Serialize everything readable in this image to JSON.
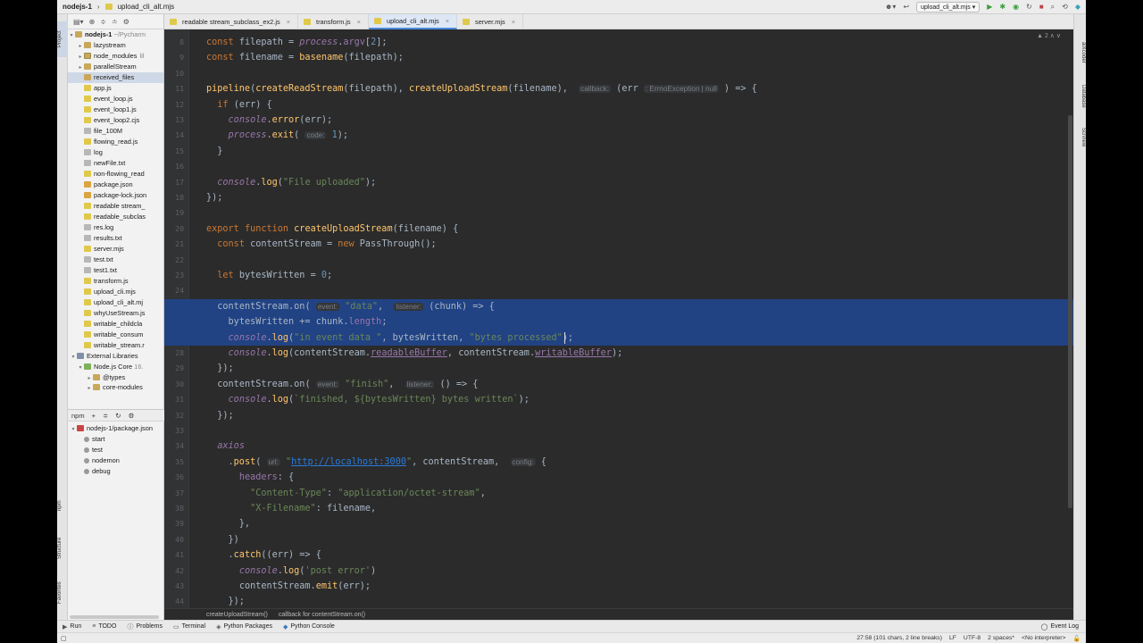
{
  "window": {
    "project": "nodejs-1",
    "current_file": "upload_cli_alt.mjs",
    "run_config": "upload_cli_alt.mjs"
  },
  "tool_windows": {
    "left": [
      "Project",
      "npm",
      "Structure",
      "Favorites"
    ],
    "right": [
      "aiXcoder",
      "Database",
      "SciView"
    ]
  },
  "project_panel": {
    "root": {
      "name": "nodejs-1",
      "path": "~/Pycharm"
    },
    "items": [
      {
        "name": "lazystream",
        "kind": "folder",
        "expandable": true
      },
      {
        "name": "node_modules",
        "kind": "folder-mod",
        "expandable": true,
        "note": "lil"
      },
      {
        "name": "parallelStream",
        "kind": "folder",
        "expandable": true
      },
      {
        "name": "received_files",
        "kind": "folder",
        "expandable": false,
        "selected": true
      },
      {
        "name": "app.js",
        "kind": "js"
      },
      {
        "name": "event_loop.js",
        "kind": "js"
      },
      {
        "name": "event_loop1.js",
        "kind": "js"
      },
      {
        "name": "event_loop2.cjs",
        "kind": "js"
      },
      {
        "name": "file_100M",
        "kind": "txt"
      },
      {
        "name": "flowing_read.js",
        "kind": "js"
      },
      {
        "name": "log",
        "kind": "txt"
      },
      {
        "name": "newFile.txt",
        "kind": "txt"
      },
      {
        "name": "non-flowing_read",
        "kind": "js"
      },
      {
        "name": "package.json",
        "kind": "json"
      },
      {
        "name": "package-lock.json",
        "kind": "json"
      },
      {
        "name": "readable stream_",
        "kind": "js"
      },
      {
        "name": "readable_subclas",
        "kind": "js"
      },
      {
        "name": "res.log",
        "kind": "txt"
      },
      {
        "name": "results.txt",
        "kind": "txt"
      },
      {
        "name": "server.mjs",
        "kind": "js"
      },
      {
        "name": "test.txt",
        "kind": "txt"
      },
      {
        "name": "test1.txt",
        "kind": "txt"
      },
      {
        "name": "transform.js",
        "kind": "js"
      },
      {
        "name": "upload_cli.mjs",
        "kind": "js"
      },
      {
        "name": "upload_cli_alt.mj",
        "kind": "js"
      },
      {
        "name": "whyUseStream.js",
        "kind": "js"
      },
      {
        "name": "writable_childcla",
        "kind": "js"
      },
      {
        "name": "writable_consum",
        "kind": "js"
      },
      {
        "name": "writable_stream.r",
        "kind": "js"
      }
    ],
    "external": {
      "label": "External Libraries",
      "node_core": "Node.js Core",
      "node_core_ver": "16.",
      "types": "@types",
      "core_modules": "core-modules"
    }
  },
  "npm_panel": {
    "title": "npm",
    "package": "nodejs-1/package.json",
    "scripts": [
      "start",
      "test",
      "nodemon",
      "debug"
    ]
  },
  "tabs": [
    {
      "label": "readable stream_subclass_ex2.js",
      "active": false
    },
    {
      "label": "transform.js",
      "active": false
    },
    {
      "label": "upload_cli_alt.mjs",
      "active": true
    },
    {
      "label": "server.mjs",
      "active": false
    }
  ],
  "editor": {
    "line_numbers": [
      "8",
      "9",
      "10",
      "11",
      "12",
      "13",
      "14",
      "15",
      "16",
      "17",
      "18",
      "19",
      "20",
      "21",
      "22",
      "23",
      "24",
      "25",
      "26",
      "27",
      "28",
      "29",
      "30",
      "31",
      "32",
      "33",
      "34",
      "35",
      "36",
      "37",
      "38",
      "39",
      "40",
      "41",
      "42",
      "43",
      "44"
    ],
    "current_line": "27",
    "inspection": "2",
    "code_lines": [
      "const filepath = process.argv[2];",
      "const filename = basename(filepath);",
      "",
      "pipeline(createReadStream(filepath), createUploadStream(filename),  callback: (err : ErrnoException | null ) => {",
      "  if (err) {",
      "    console.error(err);",
      "    process.exit( code: 1);",
      "  }",
      "",
      "  console.log(\"File uploaded\");",
      "});",
      "",
      "export function createUploadStream(filename) {",
      "  const contentStream = new PassThrough();",
      "",
      "  let bytesWritten = 0;",
      "",
      "  contentStream.on( event: \"data\",  listener: (chunk) => {",
      "    bytesWritten += chunk.length;",
      "    console.log(\"in event data \", bytesWritten, \"bytes processed\");",
      "    console.log(contentStream.readableBuffer, contentStream.writableBuffer);",
      "  });",
      "  contentStream.on( event: \"finish\",  listener: () => {",
      "    console.log(`finished, ${bytesWritten} bytes written`);",
      "  });",
      "",
      "  axios",
      "    .post( url: \"http://localhost:3000\", contentStream,  config: {",
      "      headers: {",
      "        \"Content-Type\": \"application/octet-stream\",",
      "        \"X-Filename\": filename,",
      "      },",
      "    })",
      "    .catch((err) => {",
      "      console.log('post error')",
      "      contentStream.emit(err);",
      "    });"
    ],
    "hints": {
      "callback": "callback:",
      "err_type": ": ErrnoException | null",
      "code": "code:",
      "event": "event:",
      "listener": "listener:",
      "url": "url:",
      "config": "config:"
    },
    "breadcrumb": [
      "createUploadStream()",
      "callback for contentStream.on()"
    ]
  },
  "bottom_tools": [
    "Run",
    "TODO",
    "Problems",
    "Terminal",
    "Python Packages",
    "Python Console"
  ],
  "event_log": "Event Log",
  "status": {
    "position": "27:58 (101 chars, 2 line breaks)",
    "line_sep": "LF",
    "encoding": "UTF-8",
    "indent": "2 spaces*",
    "interpreter": "<No interpreter>"
  },
  "colors": {
    "editor_bg": "#2b2b2b",
    "selection": "#214283",
    "keyword": "#cc7832",
    "function": "#ffc66d",
    "string": "#6a8759",
    "number": "#6897bb"
  }
}
